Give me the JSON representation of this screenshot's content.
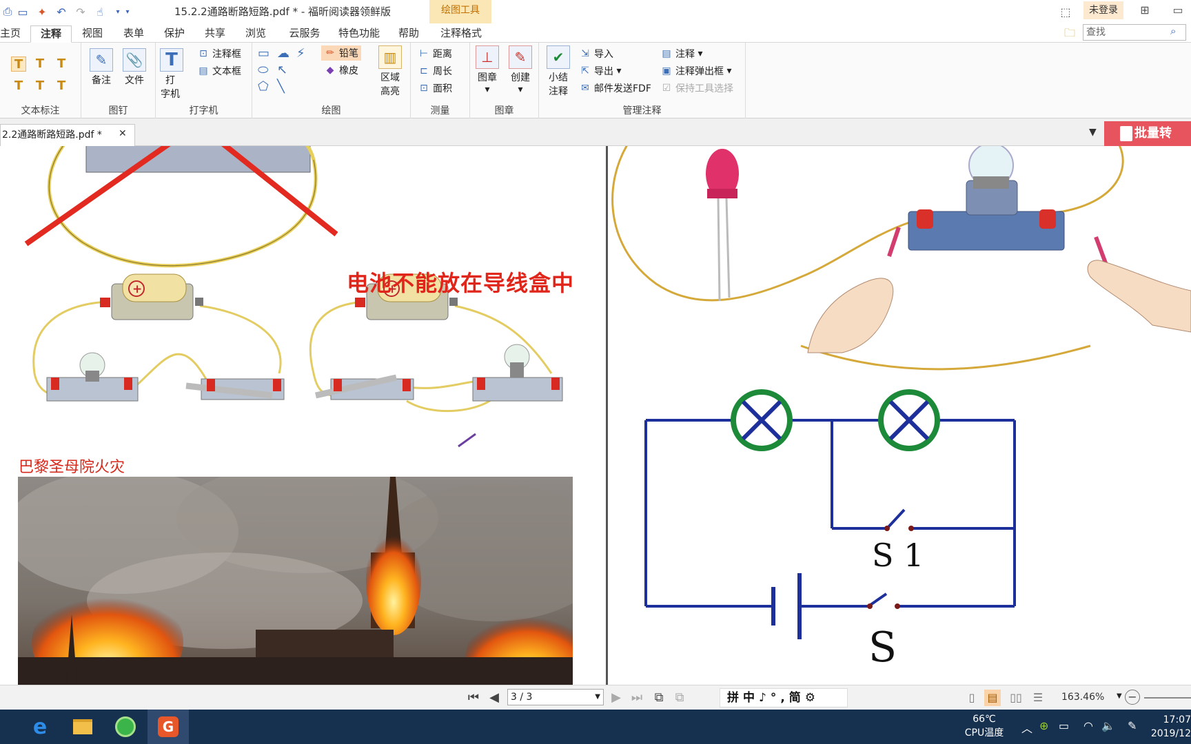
{
  "title_bar": {
    "document_title": "15.2.2通路断路短路.pdf * - 福昕阅读器领鲜版",
    "context_tab": "绘图工具",
    "login_label": "未登录",
    "quick_access_icons": [
      "print-icon",
      "window-icon",
      "new-icon",
      "undo-icon",
      "redo-icon",
      "hand-tool-icon"
    ]
  },
  "menu": {
    "tabs": [
      "主页",
      "注释",
      "视图",
      "表单",
      "保护",
      "共享",
      "浏览",
      "云服务",
      "特色功能",
      "帮助",
      "注释格式"
    ],
    "active_tab": "注释",
    "search_placeholder": "查找"
  },
  "ribbon": {
    "groups": {
      "text_markup": "文本标注",
      "pin": "图钉",
      "typewriter": "打字机",
      "drawing": "绘图",
      "measure": "测量",
      "stamp": "图章",
      "manage": "管理注释"
    },
    "pin": {
      "note": "备注",
      "file": "文件"
    },
    "typewriter": {
      "typewriter_btn": "打字机",
      "typewriter_line1": "打",
      "typewriter_line2": "字机",
      "callout": "注释框",
      "textbox": "文本框"
    },
    "drawing": {
      "pencil": "铅笔",
      "eraser": "橡皮",
      "area_highlight_1": "区域",
      "area_highlight_2": "高亮"
    },
    "measure": {
      "distance": "距离",
      "perimeter": "周长",
      "area": "面积"
    },
    "stamp": {
      "stamp": "图章",
      "create": "创建"
    },
    "manage": {
      "summary_1": "小结",
      "summary_2": "注释",
      "import": "导入",
      "export": "导出",
      "email_fdf": "邮件发送FDF",
      "comments": "注释",
      "comment_popup": "注释弹出框",
      "keep_tool": "保持工具选择"
    }
  },
  "doc_tab": {
    "label": "2.2通路断路短路.pdf *",
    "batch_button": "批量转"
  },
  "page_content": {
    "warning_text": "电池不能放在导线盒中",
    "fire_caption": "巴黎圣母院火灾",
    "switch_s1_label": "S 1",
    "switch_s_label": "S"
  },
  "status_bar": {
    "page_value": "3 / 3",
    "ime_text": "拼中♪°,简⚙",
    "zoom": "163.46%"
  },
  "taskbar": {
    "apps": [
      "edge-icon",
      "file-explorer-icon",
      "browser-icon",
      "foxit-icon"
    ],
    "temp_value": "66℃",
    "temp_label": "CPU温度",
    "time": "17:07",
    "date": "2019/12"
  },
  "colors": {
    "accent_orange": "#fbd9b8",
    "warning_red": "#e0261b",
    "taskbar_bg": "#16304f",
    "circuit_blue": "#1c2f9a",
    "lamp_green": "#1d8a3a"
  }
}
